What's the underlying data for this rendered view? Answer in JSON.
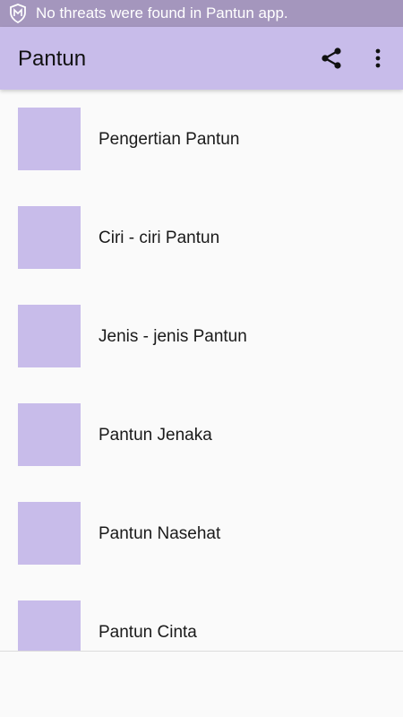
{
  "status_bar": {
    "notification_text": "No threats were found in Pantun app.",
    "icon": "shield-icon"
  },
  "app_bar": {
    "title": "Pantun",
    "share_icon": "share-icon",
    "more_icon": "more-vert-icon",
    "color": "#c8bcea"
  },
  "list": {
    "items": [
      {
        "label": "Pengertian Pantun"
      },
      {
        "label": "Ciri - ciri Pantun"
      },
      {
        "label": "Jenis - jenis Pantun"
      },
      {
        "label": "Pantun Jenaka"
      },
      {
        "label": "Pantun Nasehat"
      },
      {
        "label": "Pantun Cinta"
      }
    ]
  },
  "colors": {
    "status_bar": "#a496bd",
    "accent": "#c8bcea",
    "background": "#fafafa"
  }
}
